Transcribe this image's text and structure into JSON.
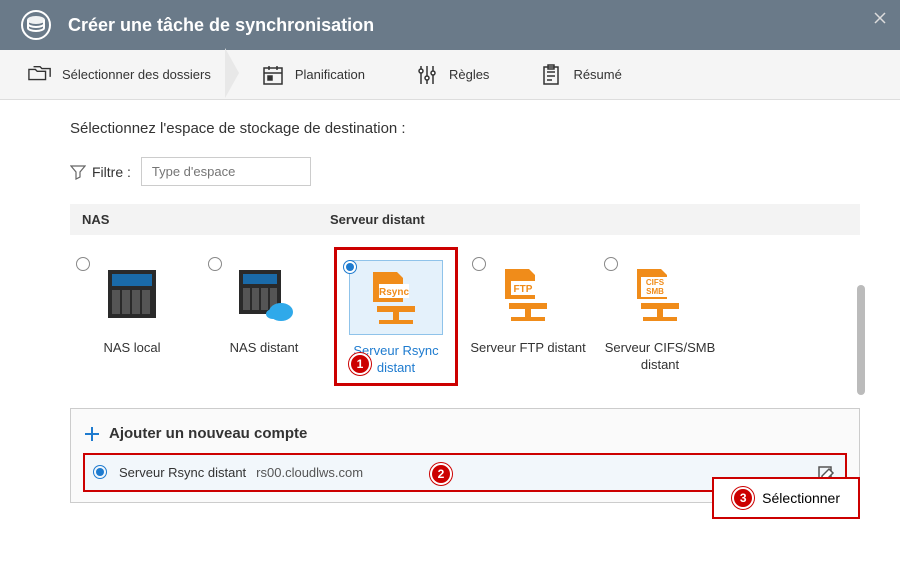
{
  "header": {
    "title": "Créer une tâche de synchronisation"
  },
  "steps": {
    "folders": "Sélectionner des dossiers",
    "schedule": "Planification",
    "rules": "Règles",
    "summary": "Résumé"
  },
  "instruction": "Sélectionnez l'espace de stockage de destination :",
  "filter": {
    "label": "Filtre :",
    "placeholder": "Type d'espace"
  },
  "categories": {
    "nas": "NAS",
    "remote": "Serveur distant"
  },
  "options": {
    "nas_local": "NAS local",
    "nas_remote": "NAS distant",
    "rsync": "Serveur Rsync distant",
    "ftp": "Serveur FTP distant",
    "cifs": "Serveur CIFS/SMB distant"
  },
  "accounts": {
    "add": "Ajouter un nouveau compte",
    "row": {
      "name": "Serveur Rsync distant",
      "host": "rs00.cloudlws.com"
    }
  },
  "actions": {
    "select": "Sélectionner"
  },
  "callouts": {
    "c1": "1",
    "c2": "2",
    "c3": "3"
  },
  "icons": {
    "rsync_text": "Rsync",
    "ftp_text": "FTP",
    "cifs_text": "CIFS\nSMB"
  }
}
